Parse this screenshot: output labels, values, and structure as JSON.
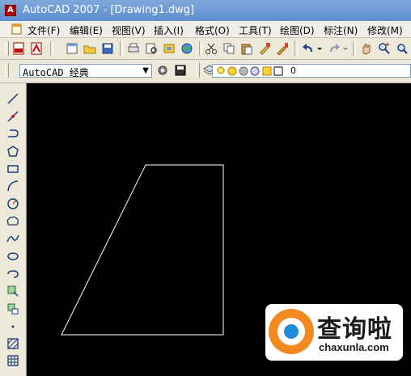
{
  "window": {
    "title": "AutoCAD 2007 - [Drawing1.dwg]"
  },
  "menu": {
    "items": [
      {
        "label": "文件(F)"
      },
      {
        "label": "编辑(E)"
      },
      {
        "label": "视图(V)"
      },
      {
        "label": "插入(I)"
      },
      {
        "label": "格式(O)"
      },
      {
        "label": "工具(T)"
      },
      {
        "label": "绘图(D)"
      },
      {
        "label": "标注(N)"
      },
      {
        "label": "修改(M)"
      }
    ]
  },
  "workspace": {
    "selected": "AutoCAD 经典"
  },
  "layer": {
    "current": "0"
  },
  "watermark": {
    "title": "查询啦",
    "subtitle": "chaxunla.com"
  },
  "colors": {
    "canvas": "#000000",
    "shape": "#ffffff",
    "watermark_accent": "#f28a1f"
  },
  "toolbar_icons": [
    "new-icon",
    "open-icon",
    "save-icon",
    "print-icon",
    "preview-icon",
    "publish-icon",
    "cut-icon",
    "copy-icon",
    "paste-icon",
    "matchprop-icon",
    "undo-icon",
    "redo-icon",
    "pan-icon",
    "zoom-icon"
  ],
  "draw_tools": [
    "line",
    "construction-line",
    "polyline",
    "polygon",
    "rectangle",
    "arc",
    "circle",
    "revision-cloud",
    "spline",
    "ellipse",
    "ellipse-arc",
    "insert-block",
    "make-block",
    "point",
    "hatch",
    "gradient"
  ]
}
